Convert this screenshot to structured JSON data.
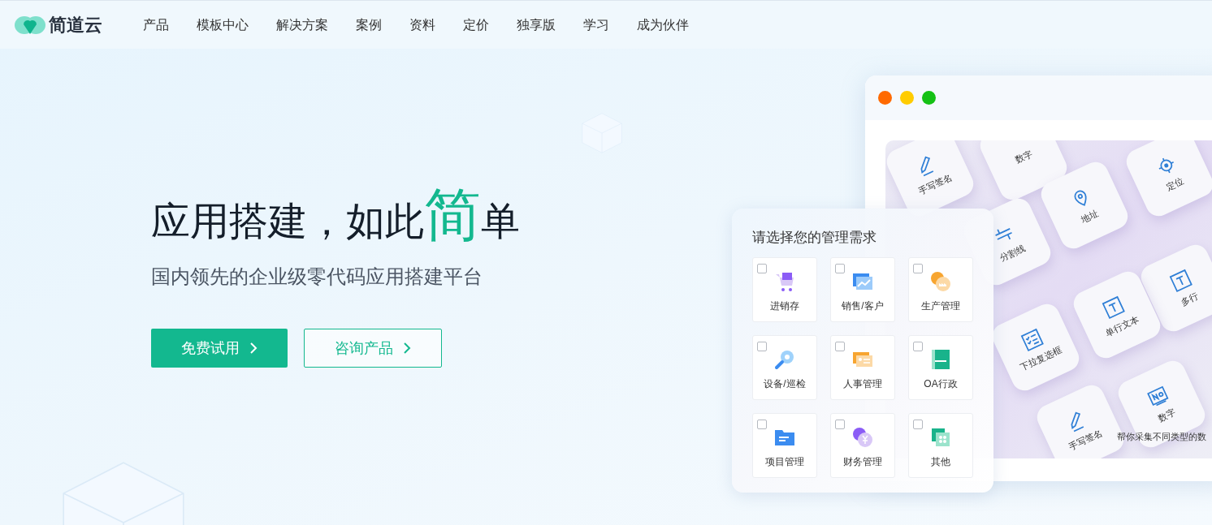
{
  "logo": {
    "text": "简道云"
  },
  "nav": [
    {
      "label": "产品"
    },
    {
      "label": "模板中心"
    },
    {
      "label": "解决方案"
    },
    {
      "label": "案例"
    },
    {
      "label": "资料"
    },
    {
      "label": "定价"
    },
    {
      "label": "独享版"
    },
    {
      "label": "学习"
    },
    {
      "label": "成为伙伴"
    }
  ],
  "hero": {
    "title_before": "应用搭建，如此",
    "title_highlight": "简",
    "title_after": "单",
    "subtitle": "国内领先的企业级零代码应用搭建平台",
    "buttons": [
      {
        "label": "免费试用",
        "kind": "primary"
      },
      {
        "label": "咨询产品",
        "kind": "outline"
      }
    ]
  },
  "mockup": {
    "keys": [
      {
        "label": "手写签名",
        "kind": "pen"
      },
      {
        "label": "数字",
        "kind": "none"
      },
      {
        "label": "定位",
        "kind": "target"
      },
      {
        "label": "地址",
        "kind": "pin"
      },
      {
        "label": "分割线",
        "kind": "divider"
      },
      {
        "label": "多行",
        "kind": "text"
      },
      {
        "label": "单行文本",
        "kind": "text"
      },
      {
        "label": "下拉复选框",
        "kind": "checklist"
      },
      {
        "label": "数字",
        "kind": "numbox"
      },
      {
        "label": "手写签名",
        "kind": "pen"
      }
    ],
    "caption": "帮你采集不同类型的数"
  },
  "panel": {
    "title": "请选择您的管理需求",
    "options": [
      {
        "label": "进销存",
        "kind": "inventory",
        "checked": false
      },
      {
        "label": "销售/客户",
        "kind": "sales",
        "checked": false
      },
      {
        "label": "生产管理",
        "kind": "production",
        "checked": false
      },
      {
        "label": "设备/巡检",
        "kind": "equipment",
        "checked": false
      },
      {
        "label": "人事管理",
        "kind": "hr",
        "checked": false
      },
      {
        "label": "OA行政",
        "kind": "oa",
        "checked": false
      },
      {
        "label": "项目管理",
        "kind": "project",
        "checked": false
      },
      {
        "label": "财务管理",
        "kind": "finance",
        "checked": false
      },
      {
        "label": "其他",
        "kind": "other",
        "checked": false
      }
    ]
  }
}
